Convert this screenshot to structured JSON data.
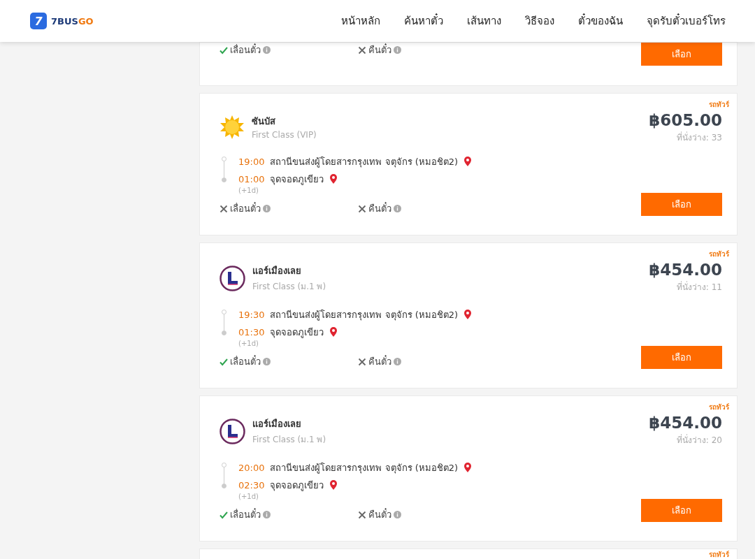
{
  "header": {
    "logo": {
      "mark": "7",
      "name": "7BUS",
      "accent": "GO"
    },
    "nav": [
      "หน้าหลัก",
      "ค้นหาตั๋ว",
      "เส้นทาง",
      "วิธีจอง",
      "ตั๋วของฉัน",
      "จุดรับตั๋วเบอร์โทร"
    ]
  },
  "trips": [
    {
      "features": [
        {
          "label": "เลื่อนตั๋ว",
          "available": true
        },
        {
          "label": "คืนตั๋ว",
          "available": false
        }
      ],
      "button": "เลือก"
    },
    {
      "tag": "รถทัวร์",
      "operator": "ซันบัส",
      "logo": {
        "kind": "sun"
      },
      "class": "First Class (VIP)",
      "price": "฿605.00",
      "seats": "ที่นั่งว่าง: 33",
      "stops": [
        {
          "time": "19:00",
          "place": "สถานีขนส่งผู้โดยสารกรุงเทพ จตุจักร (หมอชิต2)"
        },
        {
          "time": "01:00",
          "place": "จุดจอดภูเขียว",
          "note": "(+1d)"
        }
      ],
      "features": [
        {
          "label": "เลื่อนตั๋ว",
          "available": false
        },
        {
          "label": "คืนตั๋ว",
          "available": false
        }
      ],
      "button": "เลือก"
    },
    {
      "tag": "รถทัวร์",
      "operator": "แอร์เมืองเลย",
      "logo": {
        "kind": "ring"
      },
      "class": "First Class (ม.1 พ)",
      "price": "฿454.00",
      "seats": "ที่นั่งว่าง: 11",
      "stops": [
        {
          "time": "19:30",
          "place": "สถานีขนส่งผู้โดยสารกรุงเทพ จตุจักร (หมอชิต2)"
        },
        {
          "time": "01:30",
          "place": "จุดจอดภูเขียว",
          "note": "(+1d)"
        }
      ],
      "features": [
        {
          "label": "เลื่อนตั๋ว",
          "available": true
        },
        {
          "label": "คืนตั๋ว",
          "available": false
        }
      ],
      "button": "เลือก"
    },
    {
      "tag": "รถทัวร์",
      "operator": "แอร์เมืองเลย",
      "logo": {
        "kind": "ring"
      },
      "class": "First Class (ม.1 พ)",
      "price": "฿454.00",
      "seats": "ที่นั่งว่าง: 20",
      "stops": [
        {
          "time": "20:00",
          "place": "สถานีขนส่งผู้โดยสารกรุงเทพ จตุจักร (หมอชิต2)"
        },
        {
          "time": "02:30",
          "place": "จุดจอดภูเขียว",
          "note": "(+1d)"
        }
      ],
      "features": [
        {
          "label": "เลื่อนตั๋ว",
          "available": true
        },
        {
          "label": "คืนตั๋ว",
          "available": false
        }
      ],
      "button": "เลือก"
    },
    {
      "tag": "รถทัวร์"
    }
  ]
}
